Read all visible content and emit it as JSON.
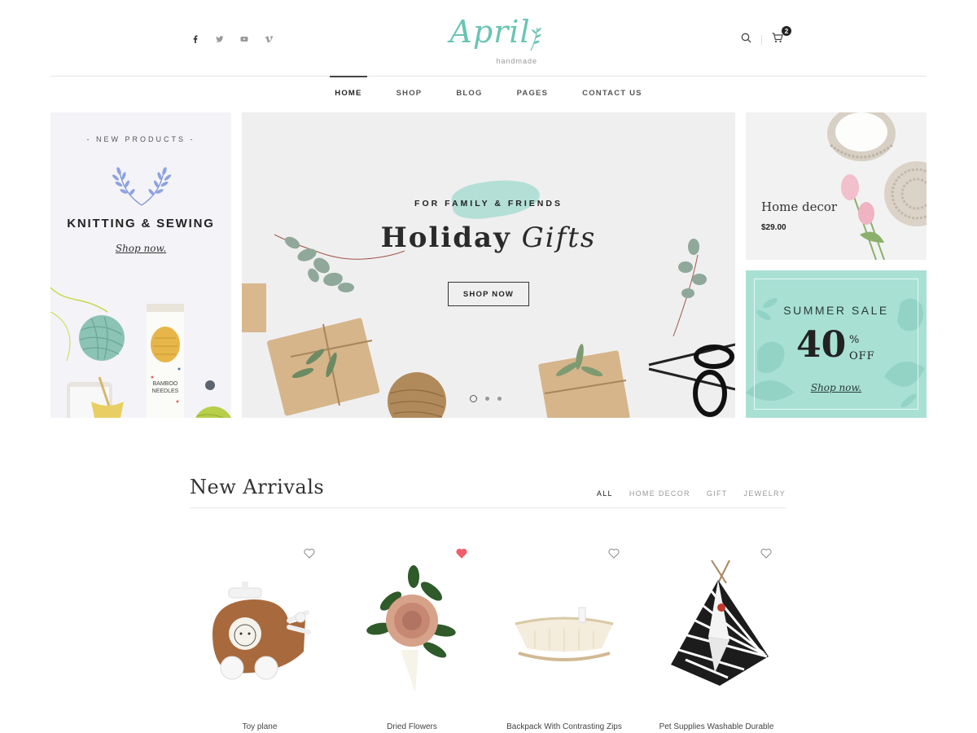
{
  "header": {
    "logo_text": "April",
    "logo_sub": "handmade",
    "socials": [
      "facebook-icon",
      "twitter-icon",
      "youtube-icon",
      "vimeo-icon"
    ],
    "cart_count": "2"
  },
  "nav": {
    "items": [
      {
        "label": "HOME",
        "active": true
      },
      {
        "label": "SHOP"
      },
      {
        "label": "BLOG"
      },
      {
        "label": "PAGES"
      },
      {
        "label": "CONTACT US"
      }
    ]
  },
  "hero_left": {
    "kicker": "- NEW PRODUCTS -",
    "title": "KNITTING & SEWING",
    "link": "Shop now."
  },
  "hero_center": {
    "kicker": "FOR FAMILY & FRIENDS",
    "title_bold": "Holiday",
    "title_italic": "Gifts",
    "button": "SHOP NOW",
    "slides": 3,
    "active_slide": 1
  },
  "hero_right_top": {
    "title": "Home decor",
    "price": "$29.00"
  },
  "hero_right_bottom": {
    "kicker": "SUMMER SALE",
    "big": "40",
    "pct": "%",
    "off": "OFF",
    "link": "Shop now."
  },
  "arrivals": {
    "title": "New Arrivals",
    "filters": [
      {
        "label": "ALL",
        "active": true
      },
      {
        "label": "HOME DECOR"
      },
      {
        "label": "GIFT"
      },
      {
        "label": "JEWELRY"
      }
    ],
    "products": [
      {
        "name": "Toy plane",
        "favorite": false
      },
      {
        "name": "Dried Flowers",
        "favorite": true
      },
      {
        "name": "Backpack With Contrasting Zips",
        "favorite": false
      },
      {
        "name": "Pet Supplies Washable Durable",
        "favorite": false
      }
    ]
  },
  "colors": {
    "accent": "#69c5b3",
    "mint_panel": "#a8e0d4",
    "heart_active": "#f0606a"
  }
}
